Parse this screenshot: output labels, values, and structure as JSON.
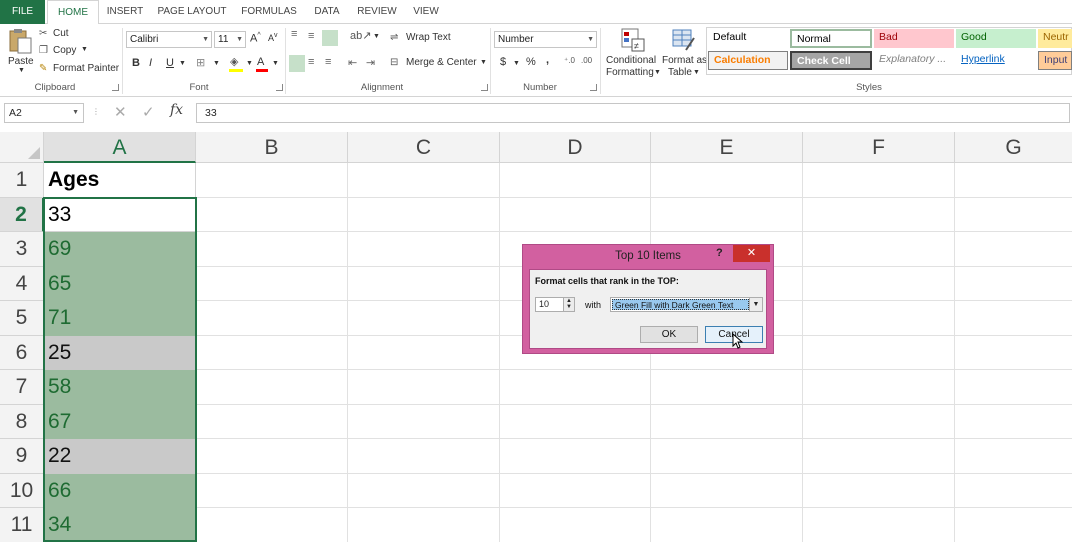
{
  "tabs": [
    "FILE",
    "HOME",
    "INSERT",
    "PAGE LAYOUT",
    "FORMULAS",
    "DATA",
    "REVIEW",
    "VIEW"
  ],
  "clipboard": {
    "paste": "Paste",
    "cut": "Cut",
    "copy": "Copy",
    "format_painter": "Format Painter",
    "label": "Clipboard"
  },
  "font": {
    "name": "Calibri",
    "size": "11",
    "label": "Font",
    "bold": "B",
    "italic": "I",
    "underline": "U"
  },
  "alignment": {
    "wrap_text": "Wrap Text",
    "merge_center": "Merge & Center",
    "label": "Alignment"
  },
  "number": {
    "format": "Number",
    "currency": "$",
    "percent": "%",
    "comma": ",",
    "label": "Number"
  },
  "conditional": {
    "line1": "Conditional",
    "line2": "Formatting"
  },
  "format_table": {
    "line1": "Format as",
    "line2": "Table"
  },
  "styles": {
    "label": "Styles",
    "items": [
      {
        "label": "Default",
        "bg": "#ffffff",
        "color": "#000000"
      },
      {
        "label": "Normal",
        "bg": "#ffffff",
        "color": "#000000"
      },
      {
        "label": "Bad",
        "bg": "#ffc7ce",
        "color": "#9c0006"
      },
      {
        "label": "Good",
        "bg": "#c6efce",
        "color": "#006100"
      },
      {
        "label": "Neutr",
        "bg": "#ffeb9c",
        "color": "#9c6500"
      },
      {
        "label": "Calculation",
        "bg": "#f2f2f2",
        "color": "#fa7d00"
      },
      {
        "label": "Check Cell",
        "bg": "#a5a5a5",
        "color": "#ffffff"
      },
      {
        "label": "Explanatory ...",
        "bg": "#ffffff",
        "color": "#7f7f7f"
      },
      {
        "label": "Hyperlink",
        "bg": "#ffffff",
        "color": "#0563c1"
      },
      {
        "label": "Input",
        "bg": "#ffcc99",
        "color": "#3f3f76"
      }
    ]
  },
  "formula_bar": {
    "name_box": "A2",
    "value": "33",
    "fx": "fx"
  },
  "columns": [
    "A",
    "B",
    "C",
    "D",
    "E",
    "F",
    "G"
  ],
  "rows": [
    {
      "num": "1",
      "value": "Ages",
      "fill": "none"
    },
    {
      "num": "2",
      "value": "33",
      "fill": "none"
    },
    {
      "num": "3",
      "value": "69",
      "fill": "green"
    },
    {
      "num": "4",
      "value": "65",
      "fill": "green"
    },
    {
      "num": "5",
      "value": "71",
      "fill": "green"
    },
    {
      "num": "6",
      "value": "25",
      "fill": "gray"
    },
    {
      "num": "7",
      "value": "58",
      "fill": "green"
    },
    {
      "num": "8",
      "value": "67",
      "fill": "green"
    },
    {
      "num": "9",
      "value": "22",
      "fill": "gray"
    },
    {
      "num": "10",
      "value": "66",
      "fill": "green"
    },
    {
      "num": "11",
      "value": "34",
      "fill": "green"
    }
  ],
  "dialog": {
    "title": "Top 10 Items",
    "help": "?",
    "prompt": "Format cells that rank in the TOP:",
    "count": "10",
    "with_label": "with",
    "format_option": "Green Fill with Dark Green Text",
    "ok": "OK",
    "cancel": "Cancel"
  },
  "colors": {
    "accent": "#217346",
    "dialog_frame": "#d260a0",
    "close_button": "#c9302c"
  }
}
